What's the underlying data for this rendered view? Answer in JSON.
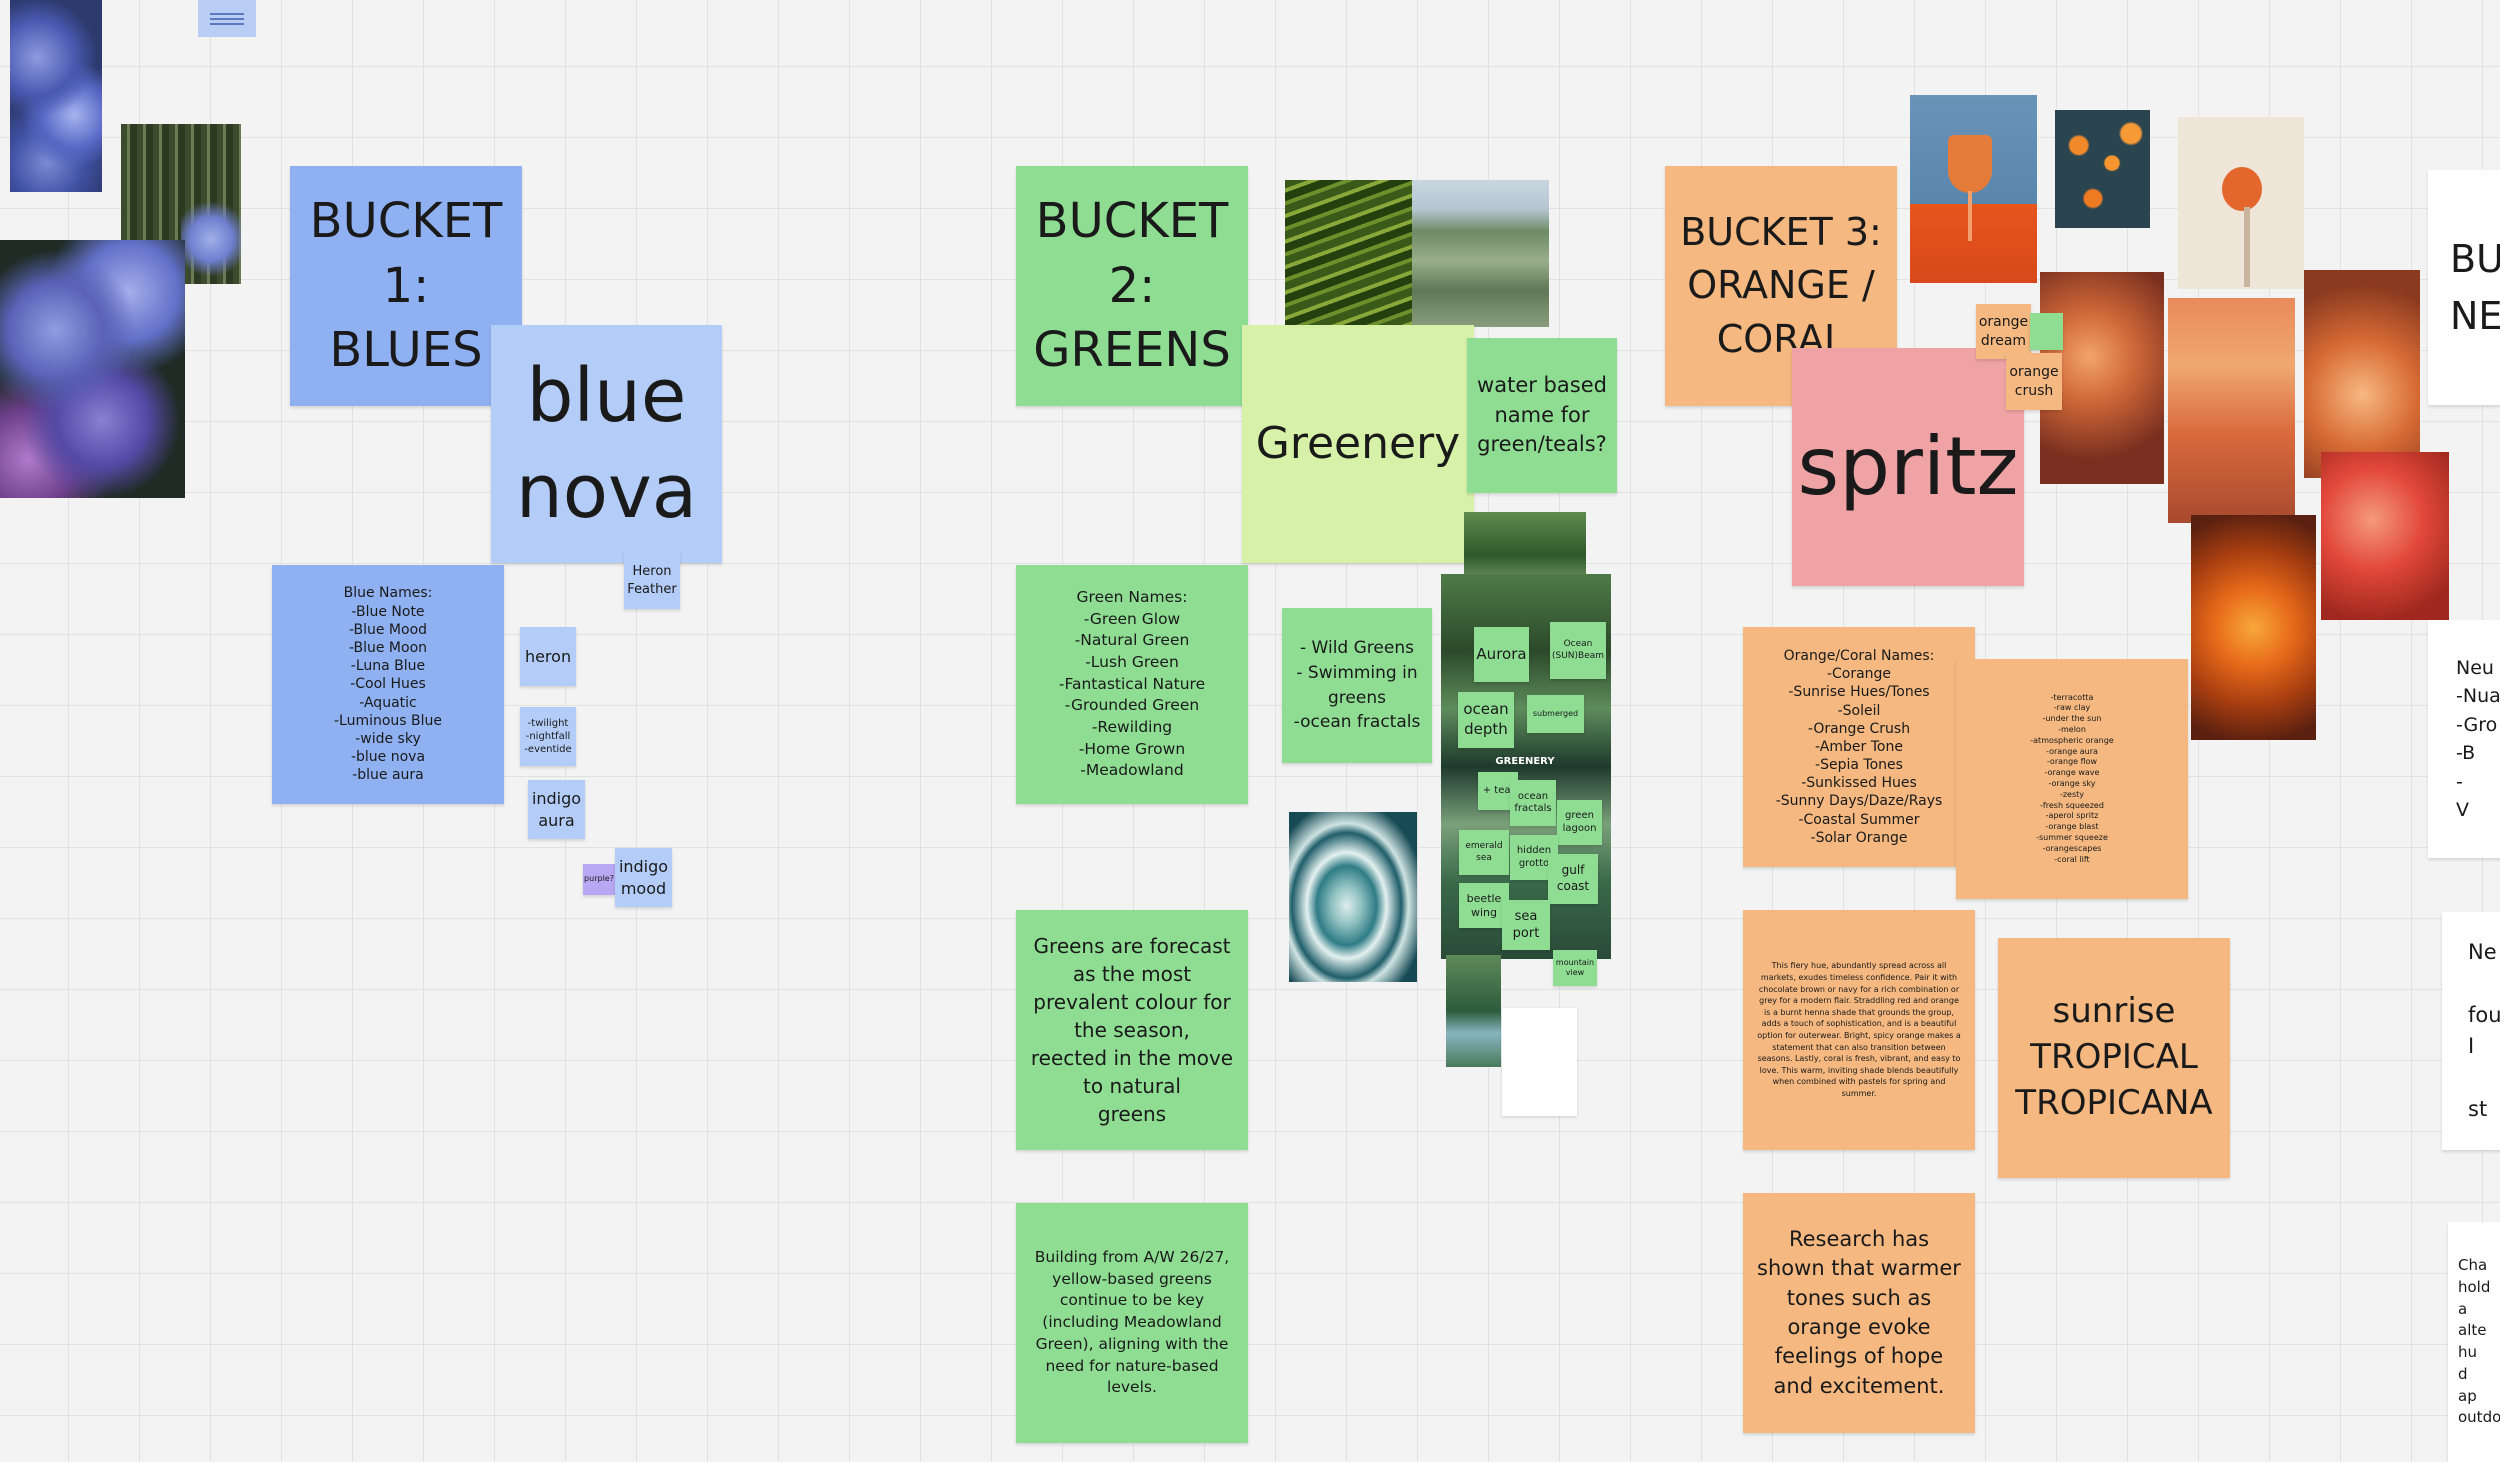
{
  "board": {
    "grid_color": "#e1e1e1",
    "background_color": "#f3f3f3",
    "doc_icon": "document-icon"
  },
  "notes": {
    "bucket1": "BUCKET\n1:\nBLUES",
    "blue_nova": "blue\nnova",
    "heron_feather": "Heron\nFeather",
    "blue_names": "Blue Names:\n-Blue Note\n-Blue Mood\n-Blue Moon\n-Luna Blue\n-Cool Hues\n-Aquatic\n-Luminous Blue\n-wide sky\n-blue nova\n-blue aura",
    "heron": "heron",
    "twilight": "-twilight\n-nightfall\n-eventide",
    "indigo_aura": "indigo\naura",
    "purple": "purple?",
    "indigo_mood": "indigo\nmood",
    "bucket2": "BUCKET\n2:\nGREENS",
    "greenery": "Greenery",
    "water_based": "water based\nname for\ngreen/teals?",
    "green_names": "Green Names:\n-Green Glow\n-Natural Green\n-Lush Green\n-Fantastical Nature\n-Grounded Green\n-Rewilding\n-Home Grown\n-Meadowland",
    "wild_greens": "- Wild Greens\n- Swimming in\ngreens\n-ocean fractals",
    "greens_forecast": "Greens are forecast\nas the most\nprevalent colour for\nthe season,\nreected in the move\nto natural\ngreens",
    "building_from": "Building from A/W 26/27,\nyellow-based greens\ncontinue to be key\n(including Meadowland\nGreen), aligning with the\nneed for nature-based\nlevels.",
    "aurora": "Aurora",
    "ocean_sunbeam": "Ocean\n(SUN)Beam",
    "ocean_depth": "ocean\ndepth",
    "submerged": "submerged",
    "greenery_label": "GREENERY",
    "teal": "+ teal",
    "ocean_fractals": "ocean\nfractals",
    "green_lagoon": "green\nlagoon",
    "emerald_sea": "emerald\nsea",
    "hidden_grotto": "hidden\ngrotto",
    "gulf_coast": "gulf\ncoast",
    "beetle_wing": "beetle\nwing",
    "sea_port": "sea\nport",
    "mountain_view": "mountain\nview",
    "bucket3": "BUCKET 3:\nORANGE /\nCORAL",
    "spritz": "spritz",
    "orange_dream": "orange\ndream",
    "orange_crush": "orange\ncrush",
    "orange_names": "Orange/Coral Names:\n-Corange\n-Sunrise Hues/Tones\n-Soleil\n-Orange Crush\n-Amber Tone\n-Sepia Tones\n-Sunkissed Hues\n-Sunny Days/Daze/Rays\n-Coastal Summer\n-Solar Orange",
    "orange_list2": "-terracotta\n-raw clay\n-under the sun\n-melon\n-atmospheric orange\n-orange aura\n-orange flow\n-orange wave\n-orange sky\n-zesty\n-fresh squeezed\n-aperol spritz\n-orange blast\n-summer squeeze\n-orangescapes\n-coral lift",
    "fiery_hue": "This fiery hue, abundantly spread across all markets, exudes timeless confidence. Pair it with chocolate brown or navy for a rich combination or grey for a modern flair. Straddling red and orange is a burnt henna shade that grounds the group, adds a touch of sophistication, and is a beautiful option for outerwear. Bright, spicy orange makes a statement that can also transition between seasons. Lastly, coral is fresh, vibrant, and easy to love. This warm, inviting shade blends beautifully when combined with pastels for spring and summer.",
    "sunrise": "sunrise\nTROPICAL\nTROPICANA",
    "research": "Research has\nshown that warmer\ntones such as\norange evoke\nfeelings of hope\nand excitement.",
    "bucket4_partial": "BU\nNE",
    "neu_partial": "Neu\n-Nua\n-Gro\n-B\n-\nV",
    "ne_partial": "Ne\n\nfour\nI\n\nst",
    "cha_partial": "Cha\nhold\na\nalte\nhu\nd\nap\noutdo"
  }
}
